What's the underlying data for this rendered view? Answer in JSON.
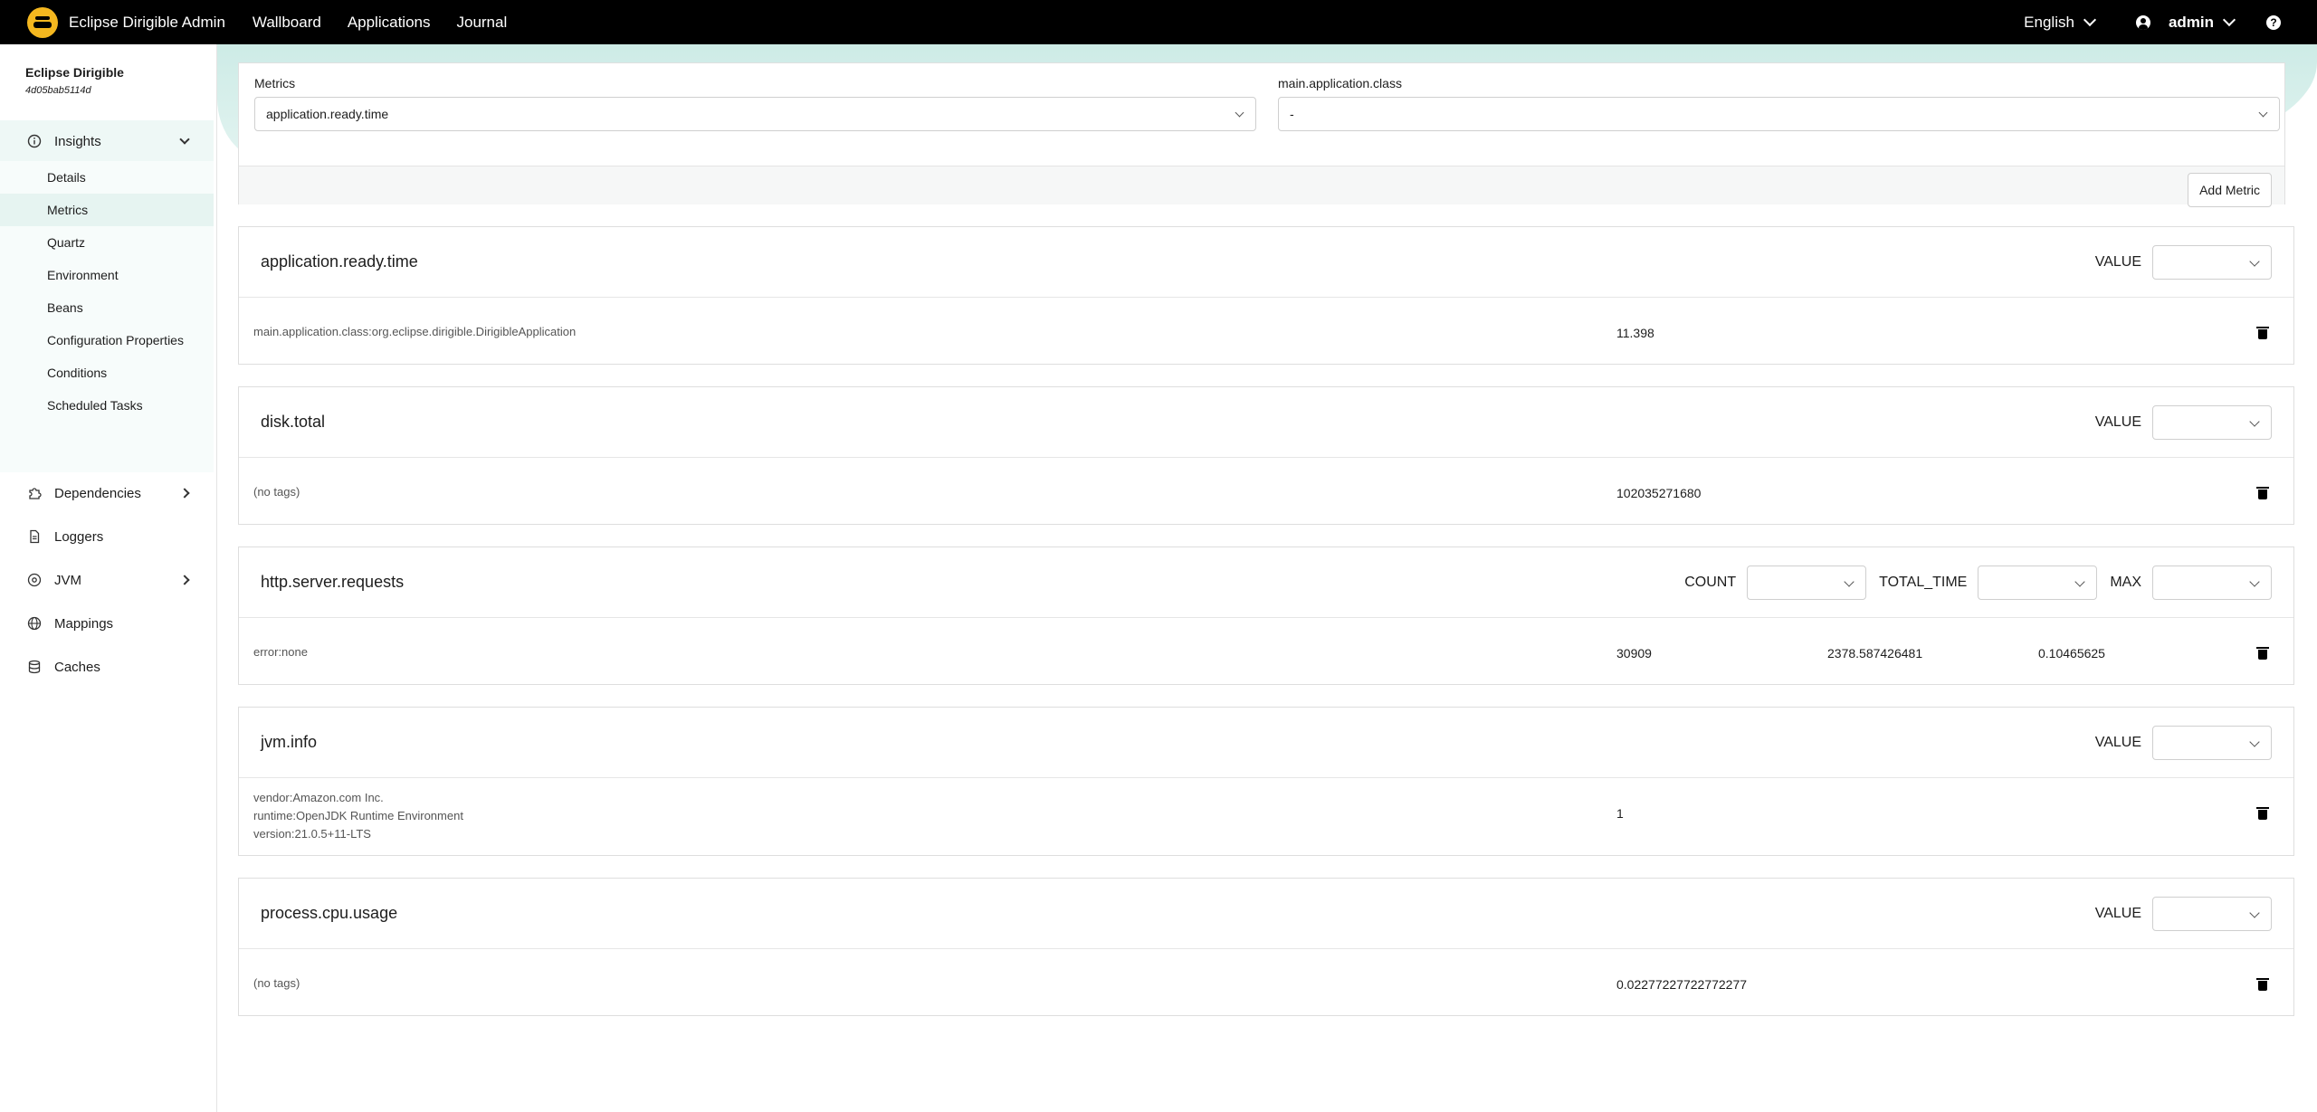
{
  "topbar": {
    "app_title": "Eclipse Dirigible Admin",
    "nav": [
      "Wallboard",
      "Applications",
      "Journal"
    ],
    "language": "English",
    "user": "admin",
    "help": "?"
  },
  "sidebar": {
    "title": "Eclipse Dirigible",
    "subtitle": "4d05bab5114d",
    "groups": {
      "insights": "Insights",
      "dependencies": "Dependencies",
      "loggers": "Loggers",
      "jvm": "JVM",
      "mappings": "Mappings",
      "caches": "Caches"
    },
    "insights_items": [
      "Details",
      "Metrics",
      "Quartz",
      "Environment",
      "Beans",
      "Configuration Properties",
      "Conditions",
      "Scheduled Tasks"
    ],
    "active_item": "Metrics"
  },
  "filter": {
    "metrics_label": "Metrics",
    "metrics_value": "application.ready.time",
    "tag_label": "main.application.class",
    "tag_value": "-",
    "add_button": "Add Metric"
  },
  "metrics": [
    {
      "name": "application.ready.time",
      "statistics": [
        "VALUE"
      ],
      "tags": [
        "main.application.class:org.eclipse.dirigible.DirigibleApplication"
      ],
      "values": [
        "11.398"
      ]
    },
    {
      "name": "disk.total",
      "statistics": [
        "VALUE"
      ],
      "tags": [
        "(no tags)"
      ],
      "values": [
        "102035271680"
      ]
    },
    {
      "name": "http.server.requests",
      "statistics": [
        "COUNT",
        "TOTAL_TIME",
        "MAX"
      ],
      "tags": [
        "error:none"
      ],
      "values": [
        "30909",
        "2378.587426481",
        "0.10465625"
      ]
    },
    {
      "name": "jvm.info",
      "statistics": [
        "VALUE"
      ],
      "tags": [
        "vendor:Amazon.com Inc.",
        "runtime:OpenJDK Runtime Environment",
        "version:21.0.5+11-LTS"
      ],
      "values": [
        "1"
      ]
    },
    {
      "name": "process.cpu.usage",
      "statistics": [
        "VALUE"
      ],
      "tags": [
        "(no tags)"
      ],
      "values": [
        "0.02277227722772277"
      ]
    }
  ],
  "colors": {
    "topbar": "#000000",
    "accent_teal": "#cdebe6",
    "logo_yellow": "#f4b71f"
  }
}
